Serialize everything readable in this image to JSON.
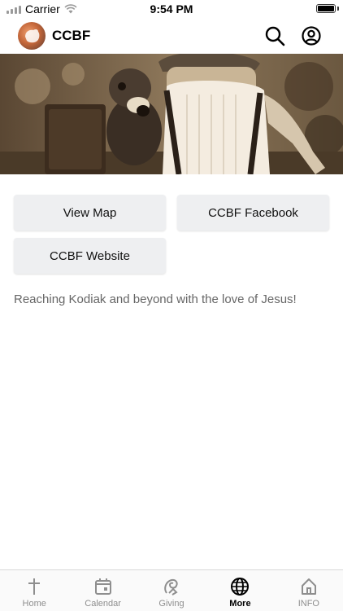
{
  "status_bar": {
    "carrier": "Carrier",
    "time": "9:54 PM"
  },
  "header": {
    "title": "CCBF",
    "search_icon": "search-icon",
    "account_icon": "account-icon"
  },
  "hero": {
    "image": "vintage-sepia-photo"
  },
  "buttons": {
    "view_map": "View Map",
    "facebook": "CCBF Facebook",
    "website": "CCBF Website"
  },
  "tagline": "Reaching Kodiak and beyond with the love of Jesus!",
  "tabs": [
    {
      "label": "Home",
      "icon": "cross-icon",
      "active": false
    },
    {
      "label": "Calendar",
      "icon": "calendar-icon",
      "active": false
    },
    {
      "label": "Giving",
      "icon": "giving-icon",
      "active": false
    },
    {
      "label": "More",
      "icon": "globe-icon",
      "active": true
    },
    {
      "label": "INFO",
      "icon": "house-icon",
      "active": false
    }
  ],
  "colors": {
    "active_tab": "#000000",
    "inactive_tab": "#8e8e8e",
    "button_bg": "#eeeff1"
  }
}
